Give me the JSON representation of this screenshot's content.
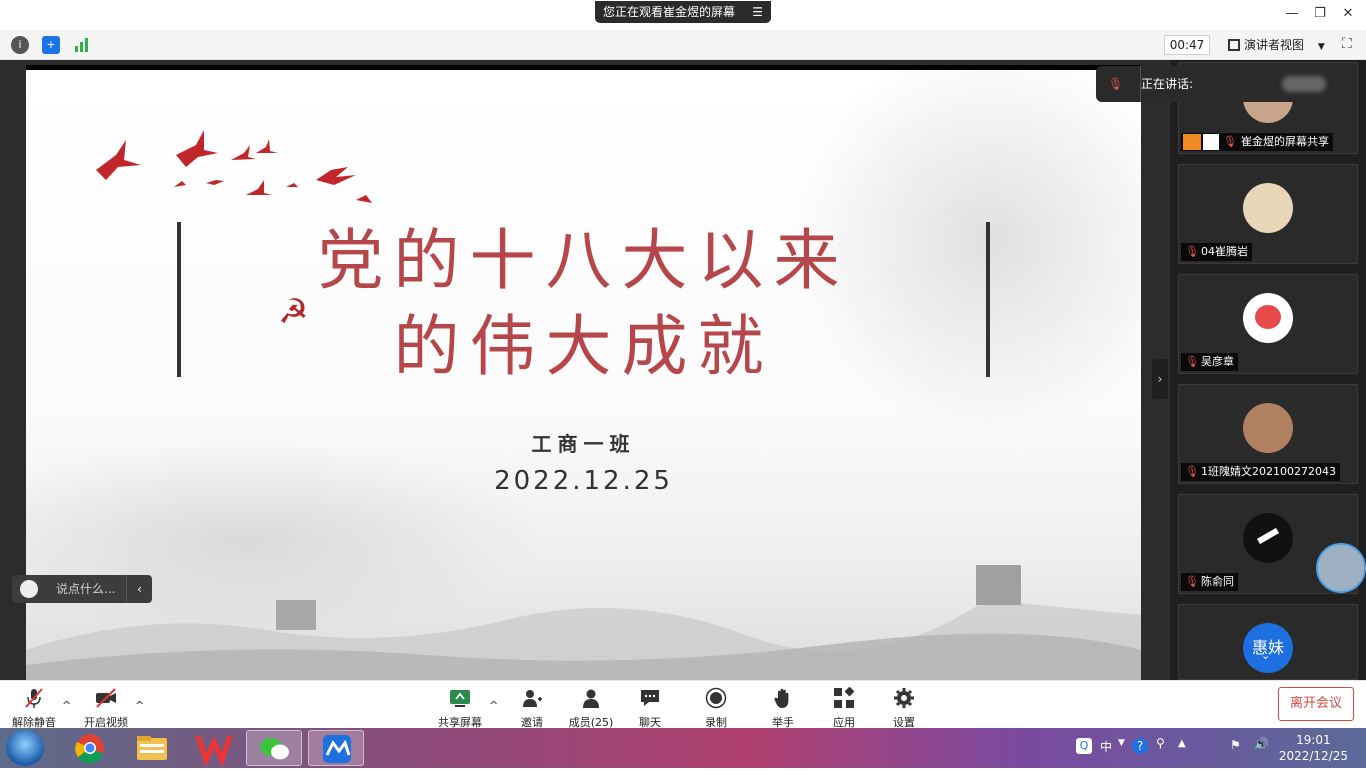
{
  "window": {
    "share_banner": "您正在观看崔金煜的屏幕",
    "controls": [
      "minimize",
      "restore",
      "close"
    ]
  },
  "toolbar": {
    "timer": "00:47",
    "view_mode": "演讲者视图"
  },
  "slide": {
    "title_line1": "党的十八大以来",
    "title_line2": "的伟大成就",
    "subtitle": "工商一班",
    "date": "2022.12.25",
    "accent_color": "#b5474a"
  },
  "chat": {
    "placeholder": "说点什么..."
  },
  "speaking": {
    "label": "正在讲话:"
  },
  "participants": [
    {
      "name": "崔金煜的屏幕共享",
      "avatar_color": "#c8a58a"
    },
    {
      "name": "04崔腾岩",
      "avatar_color": "#e8d6b8"
    },
    {
      "name": "吴彦章",
      "avatar_color": "#e64a4a"
    },
    {
      "name": "1班隗婧文202100272043",
      "avatar_color": "#b08060"
    },
    {
      "name": "陈俞同",
      "avatar_color": "#111111"
    },
    {
      "name": "惠妹",
      "avatar_color": "#1e6fe0"
    }
  ],
  "meeting_controls": {
    "unmute": "解除静音",
    "start_video": "开启视频",
    "share_screen": "共享屏幕",
    "invite": "邀请",
    "members": "成员(25)",
    "chat": "聊天",
    "record": "录制",
    "raise_hand": "举手",
    "apps": "应用",
    "settings": "设置",
    "leave": "离开会议"
  },
  "taskbar": {
    "tray_lang": "中",
    "time": "19:01",
    "date": "2022/12/25"
  }
}
